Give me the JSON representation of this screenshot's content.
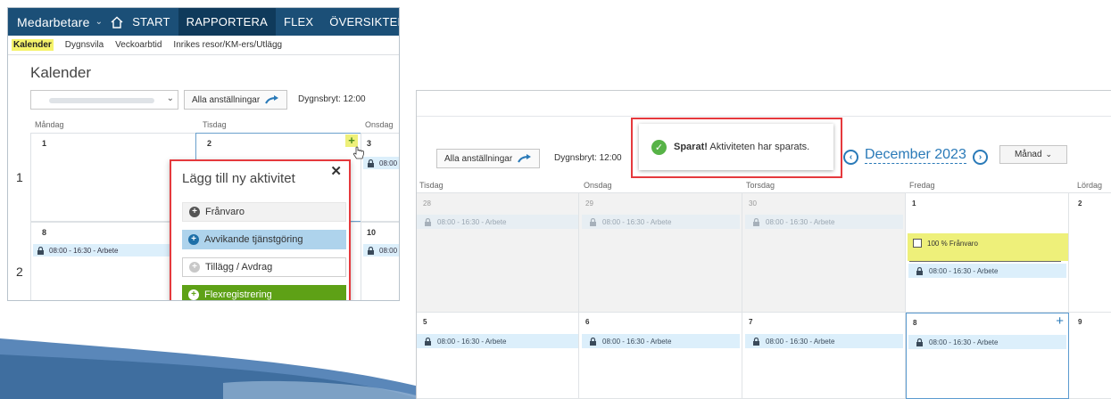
{
  "left": {
    "brand": "Medarbetare",
    "nav_tabs": [
      "START",
      "RAPPORTERA",
      "FLEX",
      "ÖVERSIKTER"
    ],
    "sub_tabs": [
      "Kalender",
      "Dygnsvila",
      "Veckoarbtid",
      "Inrikes resor/KM-ers/Utlägg"
    ],
    "title": "Kalender",
    "all_employees_button": "Alla anställningar",
    "day_break": "Dygnsbryt: 12:00",
    "day_headers": [
      "Måndag",
      "Tisdag",
      "Onsdag"
    ],
    "week_numbers": [
      "1",
      "2"
    ],
    "day_numbers": [
      "1",
      "2",
      "3",
      "8",
      "10"
    ],
    "event_label": "08:00 - 16:30 - Arbete",
    "event_short": "08:00",
    "popup": {
      "title": "Lägg till ny aktivitet",
      "buttons": [
        "Frånvaro",
        "Avvikande tjänstgöring",
        "Tillägg / Avdrag",
        "Flexregistrering"
      ]
    }
  },
  "right": {
    "all_employees_button": "Alla anställningar",
    "day_break": "Dygnsbryt: 12:00",
    "toast_bold": "Sparat!",
    "toast_text": " Aktiviteten har sparats.",
    "month": "December 2023",
    "view_button": "Månad",
    "day_headers": [
      "Tisdag",
      "Onsdag",
      "Torsdag",
      "Fredag",
      "Lördag"
    ],
    "week1_days": [
      "28",
      "29",
      "30",
      "1",
      "2"
    ],
    "week2_days": [
      "5",
      "6",
      "7",
      "8",
      "9"
    ],
    "event_label": "08:00 - 16:30 - Arbete",
    "absence_label": "100 % Frånvaro"
  },
  "colors": {
    "nav_bg": "#1b4f77",
    "accent_blue": "#2a7ab8",
    "highlight": "#eef07a",
    "red_frame": "#e5393d",
    "flex_green": "#5ea116",
    "event_bg": "#dceffb"
  }
}
